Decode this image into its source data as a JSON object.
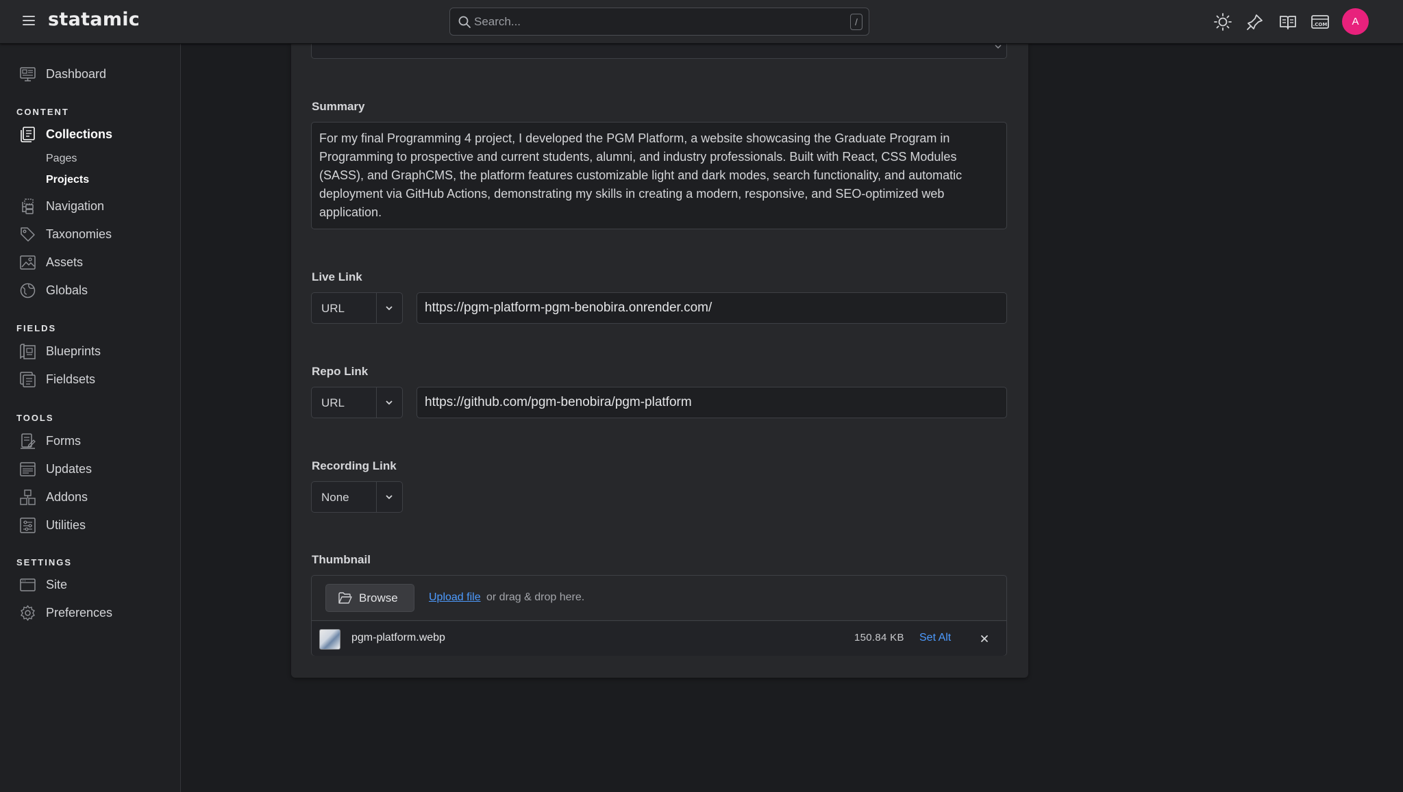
{
  "app": {
    "logo": "statamic"
  },
  "search": {
    "placeholder": "Search...",
    "shortcut": "/"
  },
  "user": {
    "avatar_initial": "A",
    "avatar_color": "#e8217c"
  },
  "sidebar": {
    "dashboard": "Dashboard",
    "sections": {
      "content": "CONTENT",
      "fields": "FIELDS",
      "tools": "TOOLS",
      "settings": "SETTINGS"
    },
    "content_items": {
      "collections": "Collections",
      "pages": "Pages",
      "projects": "Projects",
      "navigation": "Navigation",
      "taxonomies": "Taxonomies",
      "assets": "Assets",
      "globals": "Globals"
    },
    "fields_items": {
      "blueprints": "Blueprints",
      "fieldsets": "Fieldsets"
    },
    "tools_items": {
      "forms": "Forms",
      "updates": "Updates",
      "addons": "Addons",
      "utilities": "Utilities"
    },
    "settings_items": {
      "site": "Site",
      "preferences": "Preferences"
    }
  },
  "form": {
    "summary": {
      "label": "Summary",
      "value": "For my final Programming 4 project, I developed the PGM Platform, a website showcasing the Graduate Program in Programming to prospective and current students, alumni, and industry professionals. Built with React, CSS Modules (SASS), and GraphCMS, the platform features customizable light and dark modes, search functionality, and automatic deployment via GitHub Actions, demonstrating my skills in creating a modern, responsive, and SEO-optimized web application."
    },
    "live_link": {
      "label": "Live Link",
      "type": "URL",
      "value": "https://pgm-platform-pgm-benobira.onrender.com/"
    },
    "repo_link": {
      "label": "Repo Link",
      "type": "URL",
      "value": "https://github.com/pgm-benobira/pgm-platform"
    },
    "recording_link": {
      "label": "Recording Link",
      "type": "None"
    },
    "thumbnail": {
      "label": "Thumbnail",
      "browse": "Browse",
      "upload_link": "Upload file",
      "drop_text": "or drag & drop here.",
      "file": {
        "name": "pgm-platform.webp",
        "size": "150.84 KB",
        "set_alt": "Set Alt"
      }
    }
  },
  "colors": {
    "accent_link": "#4d9bff",
    "background": "#1b1c1f",
    "card": "#27282b"
  }
}
